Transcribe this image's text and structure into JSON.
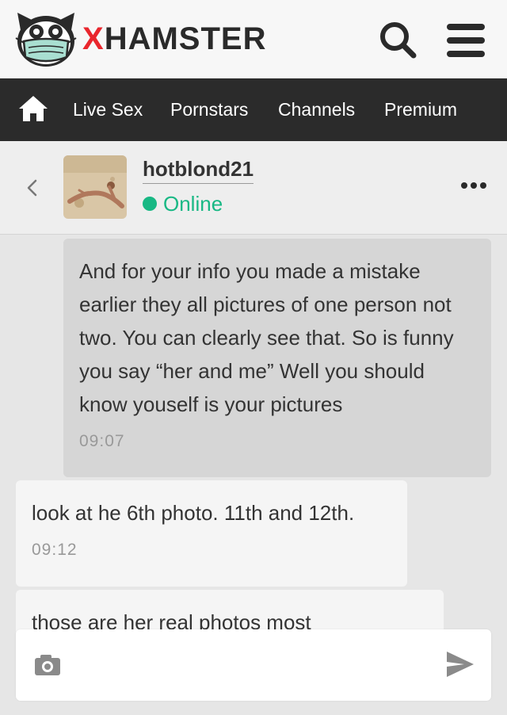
{
  "header": {
    "logo_text_accent": "X",
    "logo_text_rest": "HAMSTER",
    "search_icon": "search-icon",
    "menu_icon": "hamburger-menu-icon"
  },
  "nav": {
    "home_icon": "home-icon",
    "items": [
      "Live Sex",
      "Pornstars",
      "Channels",
      "Premium"
    ]
  },
  "chat": {
    "username": "hotblond21",
    "status": "Online",
    "status_color": "#18b884"
  },
  "messages": [
    {
      "direction": "outgoing",
      "text": "And for your info you made a mistake earlier they all pictures of one person not two. You can clearly see that. So is funny you say “her and me” Well you should know youself is your pictures",
      "time": "09:07"
    },
    {
      "direction": "incoming",
      "text": "look at he 6th photo. 11th and 12th.",
      "time": "09:12"
    },
    {
      "direction": "incoming",
      "text": "those are her real photos most",
      "time": ""
    }
  ],
  "compose": {
    "placeholder": "",
    "camera_icon": "camera-icon",
    "send_icon": "send-icon"
  },
  "colors": {
    "brand_red": "#e9262d",
    "nav_bg": "#2b2b2b",
    "online_green": "#18b884"
  }
}
